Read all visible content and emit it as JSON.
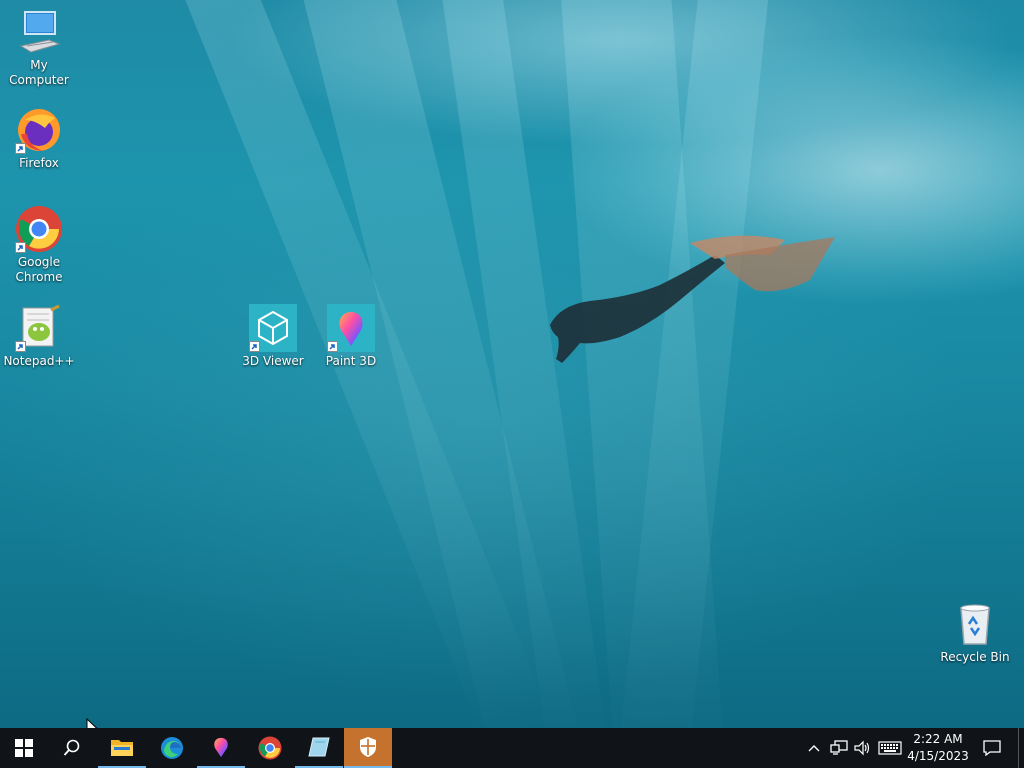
{
  "desktop": {
    "icons": [
      {
        "label": "My Computer",
        "icon": "computer-icon"
      },
      {
        "label": "Firefox",
        "icon": "firefox-icon"
      },
      {
        "label": "Google Chrome",
        "icon": "chrome-icon"
      },
      {
        "label": "Notepad++",
        "icon": "notepadpp-icon"
      },
      {
        "label": "3D Viewer",
        "icon": "3d-viewer-icon"
      },
      {
        "label": "Paint 3D",
        "icon": "paint-3d-icon"
      },
      {
        "label": "Recycle Bin",
        "icon": "recycle-bin-icon"
      }
    ],
    "wallpaper": "underwater diver"
  },
  "taskbar": {
    "items": [
      {
        "name": "start",
        "icon": "windows-logo-icon"
      },
      {
        "name": "search",
        "icon": "search-icon"
      },
      {
        "name": "file-explorer",
        "icon": "folder-icon",
        "running": true
      },
      {
        "name": "edge",
        "icon": "edge-icon"
      },
      {
        "name": "paint-3d",
        "icon": "paint-3d-icon",
        "running": true
      },
      {
        "name": "chrome",
        "icon": "chrome-icon"
      },
      {
        "name": "snip",
        "icon": "snip-icon",
        "running": true
      },
      {
        "name": "security",
        "icon": "shield-icon",
        "active": true
      }
    ],
    "tray": {
      "icons": [
        "chevron-up-icon",
        "network-icon",
        "volume-icon",
        "keyboard-icon"
      ],
      "time": "2:22 AM",
      "date": "4/15/2023",
      "notification_icon": "action-center-icon"
    },
    "colors": {
      "background": "#101418",
      "active": "#c4722e",
      "running_underline": "#76b9ed"
    }
  }
}
